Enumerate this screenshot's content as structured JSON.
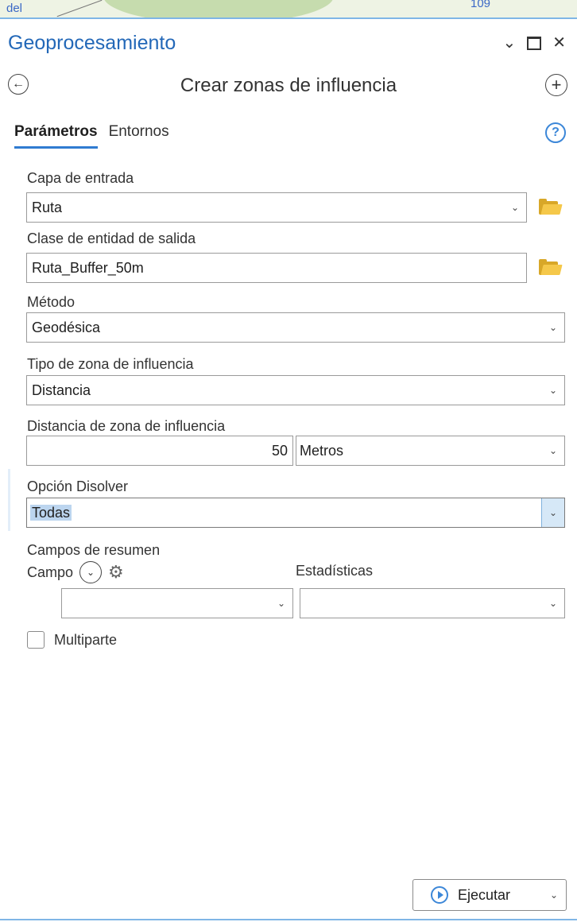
{
  "map": {
    "left_label": "del",
    "right_label": "109"
  },
  "pane": {
    "title": "Geoprocesamiento",
    "controls": {
      "options": "⌄",
      "maximize": "",
      "close": "✕"
    }
  },
  "tool": {
    "title": "Crear zonas de influencia",
    "back_icon": "←",
    "add_icon": "+"
  },
  "tabs": [
    {
      "label": "Parámetros",
      "active": true
    },
    {
      "label": "Entornos",
      "active": false
    }
  ],
  "help_icon": "?",
  "fields": {
    "input_layer": {
      "label": "Capa de entrada",
      "value": "Ruta"
    },
    "output_class": {
      "label": "Clase de entidad de salida",
      "value": "Ruta_Buffer_50m"
    },
    "method": {
      "label": "Método",
      "value": "Geodésica"
    },
    "buffer_type": {
      "label": "Tipo de zona de influencia",
      "value": "Distancia"
    },
    "distance": {
      "label": "Distancia de zona de influencia",
      "value": "50",
      "unit": "Metros"
    },
    "dissolve": {
      "label": "Opción Disolver",
      "value": "Todas"
    },
    "summary": {
      "label": "Campos de resumen",
      "field_label": "Campo",
      "stats_label": "Estadísticas",
      "field_value": "",
      "stats_value": ""
    },
    "multipart": {
      "label": "Multiparte",
      "checked": false
    }
  },
  "run": {
    "label": "Ejecutar"
  },
  "icons": {
    "chevron": "⌄",
    "gear": "⚙"
  },
  "colors": {
    "accent": "#2368b8",
    "tab_underline": "#2f7bd1",
    "folder": "#f5c84a",
    "selection": "#bcd5ef"
  }
}
